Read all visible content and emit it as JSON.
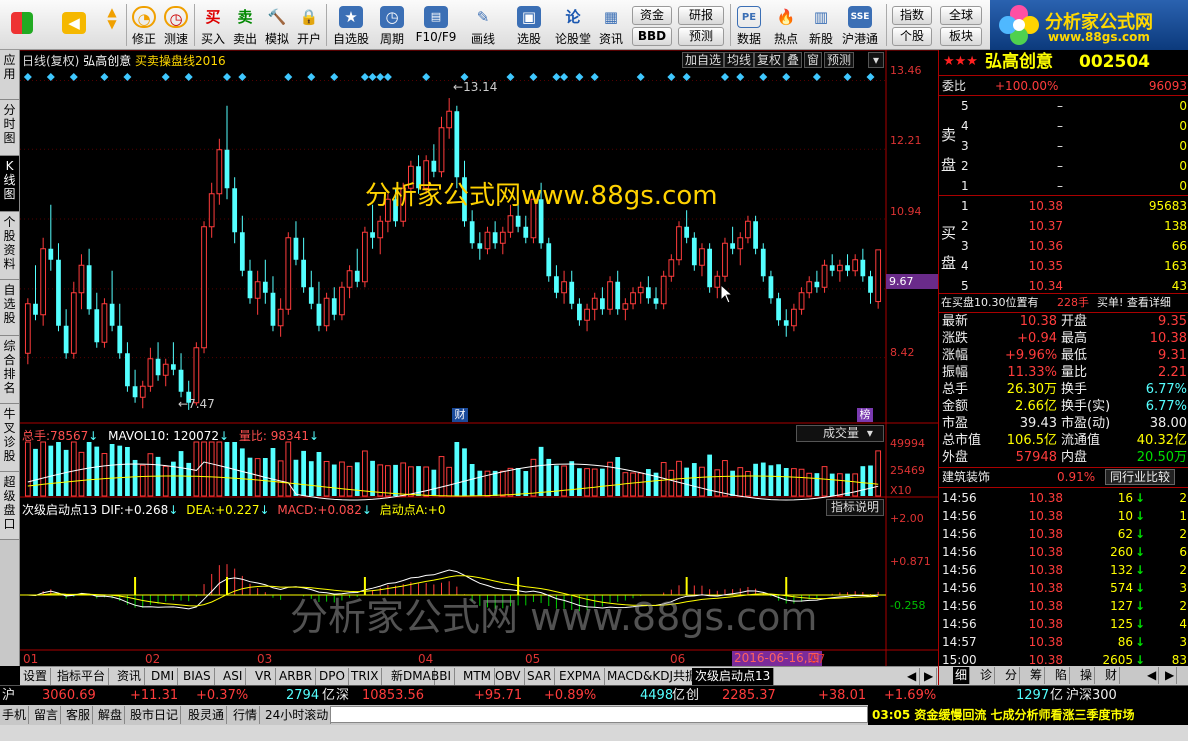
{
  "toolbar": {
    "buttons": [
      {
        "label": "",
        "icon": "windows-logo-icon"
      },
      {
        "label": "",
        "icon": "back-arrow-icon"
      },
      {
        "label": "",
        "icon": "up-down-arrow-icon"
      },
      {
        "label": "修正",
        "icon": "fix-icon"
      },
      {
        "label": "测速",
        "icon": "speedtest-clock-icon"
      },
      {
        "label": "买入",
        "icon": "buy-icon",
        "glyph": "买"
      },
      {
        "label": "卖出",
        "icon": "sell-icon",
        "glyph": "卖"
      },
      {
        "label": "模拟",
        "icon": "hammer-icon"
      },
      {
        "label": "开户",
        "icon": "lock-icon"
      },
      {
        "label": "自选股",
        "icon": "star-icon"
      },
      {
        "label": "周期",
        "icon": "clock-icon"
      },
      {
        "label": "F10/F9",
        "icon": "f10-icon"
      },
      {
        "label": "画线",
        "icon": "pencil-icon"
      },
      {
        "label": "选股",
        "icon": "monitor-icon"
      },
      {
        "label": "论股堂",
        "icon": "discuss-icon",
        "glyph": "论"
      },
      {
        "label": "资讯",
        "icon": "document-icon"
      },
      {
        "label": "数据",
        "icon": "pe-icon",
        "glyph": "PE"
      },
      {
        "label": "热点",
        "icon": "fire-icon"
      },
      {
        "label": "新股",
        "icon": "newstock-icon"
      },
      {
        "label": "沪港通",
        "icon": "shhk-icon"
      }
    ],
    "small_buttons": [
      "资金",
      "BBD",
      "研报",
      "预测",
      "指数",
      "个股",
      "全球",
      "板块"
    ]
  },
  "logo": {
    "title": "分析家公式网",
    "url": "www.88gs.com"
  },
  "left_tabs": [
    "应用",
    "分时图",
    "K线图",
    "个股资料",
    "自选股",
    "综合排名",
    "牛叉诊股",
    "超级盘口"
  ],
  "active_left_tab": "K线图",
  "chart": {
    "title_prefix": "日线(复权)",
    "stock_name": "弘高创意",
    "indicator_name": "买卖操盘线2016",
    "top_tools": [
      "加自选",
      "均线",
      "复权",
      "叠",
      "窗",
      "预测"
    ],
    "price_axis": [
      "13.46",
      "12.21",
      "10.94",
      "9.67",
      "8.42"
    ],
    "current_price_tag": "9.67",
    "high_label": "13.14",
    "low_label": "7.47",
    "watermark_top": "分析家公式网www.88gs.com",
    "watermark_bottom": "分析家公式网 www.88gs.com",
    "cai_badge": "财",
    "bang_badge": "榜",
    "vol_header": {
      "label": "总手:",
      "value": "78567",
      "ma_label": "MAVOL10:",
      "ma_value": "120072",
      "ratio_label": "量比:",
      "ratio_value": "98341"
    },
    "vol_dropdown": "成交量",
    "vol_axis": [
      "49994",
      "25469",
      "X10"
    ],
    "macd_header": {
      "name": "次级启动点13",
      "dif_label": "DIF:",
      "dif": "+0.268",
      "dea_label": "DEA:",
      "dea": "+0.227",
      "macd_label": "MACD:",
      "macd": "+0.082",
      "qd_label": "启动点A:",
      "qd": "+0"
    },
    "macd_button": "指标说明",
    "macd_axis": [
      "+2.00",
      "+0.871",
      "-0.258"
    ],
    "months": [
      "01",
      "02",
      "03",
      "04",
      "05",
      "06",
      "07"
    ],
    "date_tag": "2016-06-16,四"
  },
  "bottom_tabs": [
    "设置",
    "指标平台",
    "资讯",
    "DMI",
    "BIAS",
    "ASI",
    "VR",
    "ARBR",
    "DPO",
    "TRIX",
    "新DMA",
    "BBI",
    "MTM",
    "OBV",
    "SAR",
    "EXPMA",
    "MACD&KDJ共振",
    "次级启动点13"
  ],
  "active_bottom_tab": "次级启动点13",
  "right_panel": {
    "stars": "★★★",
    "name": "弘高创意",
    "code": "002504",
    "weibi_label": "委比",
    "weibi": "+100.00%",
    "weicha": "96093",
    "sell_label": [
      "卖",
      "盘"
    ],
    "buy_label": [
      "买",
      "盘"
    ],
    "sells": [
      {
        "lvl": "5",
        "price": "–",
        "vol": "0"
      },
      {
        "lvl": "4",
        "price": "–",
        "vol": "0"
      },
      {
        "lvl": "3",
        "price": "–",
        "vol": "0"
      },
      {
        "lvl": "2",
        "price": "–",
        "vol": "0"
      },
      {
        "lvl": "1",
        "price": "–",
        "vol": "0"
      }
    ],
    "buys": [
      {
        "lvl": "1",
        "price": "10.38",
        "vol": "95683"
      },
      {
        "lvl": "2",
        "price": "10.37",
        "vol": "138"
      },
      {
        "lvl": "3",
        "price": "10.36",
        "vol": "66"
      },
      {
        "lvl": "4",
        "price": "10.35",
        "vol": "163"
      },
      {
        "lvl": "5",
        "price": "10.34",
        "vol": "43"
      }
    ],
    "queue_text": "在买盘10.30位置有",
    "queue_vol": "228手",
    "queue_tail": "买单! 查看详细",
    "quotes": [
      {
        "l1": "最新",
        "v1": "10.38",
        "l2": "开盘",
        "v2": "9.35"
      },
      {
        "l1": "涨跌",
        "v1": "+0.94",
        "l2": "最高",
        "v2": "10.38"
      },
      {
        "l1": "涨幅",
        "v1": "+9.96%",
        "l2": "最低",
        "v2": "9.31"
      },
      {
        "l1": "振幅",
        "v1": "11.33%",
        "l2": "量比",
        "v2": "2.21"
      },
      {
        "l1": "总手",
        "v1": "26.30万",
        "l2": "换手",
        "v2": "6.77%"
      },
      {
        "l1": "金额",
        "v1": "2.66亿",
        "l2": "换手(实)",
        "v2": "6.77%"
      },
      {
        "l1": "市盈",
        "v1": "39.43",
        "l2": "市盈(动)",
        "v2": "38.00"
      },
      {
        "l1": "总市值",
        "v1": "106.5亿",
        "l2": "流通值",
        "v2": "40.32亿"
      },
      {
        "l1": "外盘",
        "v1": "57948",
        "l2": "内盘",
        "v2": "20.50万"
      }
    ],
    "industry": "建筑装饰",
    "industry_pct": "0.91%",
    "industry_btn": "同行业比较",
    "ticks": [
      {
        "t": "14:56",
        "p": "10.38",
        "v": "16",
        "n": "2"
      },
      {
        "t": "14:56",
        "p": "10.38",
        "v": "10",
        "n": "1"
      },
      {
        "t": "14:56",
        "p": "10.38",
        "v": "62",
        "n": "2"
      },
      {
        "t": "14:56",
        "p": "10.38",
        "v": "260",
        "n": "6"
      },
      {
        "t": "14:56",
        "p": "10.38",
        "v": "132",
        "n": "2"
      },
      {
        "t": "14:56",
        "p": "10.38",
        "v": "574",
        "n": "3"
      },
      {
        "t": "14:56",
        "p": "10.38",
        "v": "127",
        "n": "2"
      },
      {
        "t": "14:56",
        "p": "10.38",
        "v": "125",
        "n": "4"
      },
      {
        "t": "14:57",
        "p": "10.38",
        "v": "86",
        "n": "3"
      },
      {
        "t": "15:00",
        "p": "10.38",
        "v": "2605",
        "n": "83"
      }
    ],
    "tabs": [
      "细",
      "诊",
      "分",
      "筹",
      "陷",
      "操",
      "财"
    ]
  },
  "status1": {
    "sh_label": "沪",
    "sh": "3060.69",
    "sh_chg": "+11.31",
    "sh_pct": "+0.37%",
    "sh_amt": "2794",
    "yi": "亿",
    "sz_label": "深",
    "sz": "10853.56",
    "sz_chg": "+95.71",
    "sz_pct": "+0.89%",
    "sz_amt": "4498",
    "cy_label": "创",
    "cy": "2285.37",
    "cy_chg": "+38.01",
    "cy_pct": "+1.69%",
    "cy_amt": "1297",
    "hs300": "沪深300"
  },
  "status2": {
    "buttons": [
      "手机",
      "留言",
      "客服",
      "解盘",
      "股市日记",
      "股灵通",
      "行情",
      "24小时滚动"
    ],
    "news": "03:05 资金缓慢回流 七成分析师看涨三季度市场"
  },
  "candles": [
    [
      8.5,
      9.5,
      8.3,
      9.4
    ],
    [
      9.4,
      10.1,
      9.1,
      9.2
    ],
    [
      9.2,
      10.6,
      9.0,
      10.4
    ],
    [
      10.4,
      11.2,
      10.0,
      10.2
    ],
    [
      10.2,
      10.5,
      8.9,
      9.0
    ],
    [
      9.0,
      9.3,
      8.4,
      8.5
    ],
    [
      8.5,
      9.8,
      8.4,
      9.6
    ],
    [
      9.6,
      10.3,
      9.3,
      10.1
    ],
    [
      10.1,
      10.4,
      9.2,
      9.3
    ],
    [
      9.3,
      9.6,
      8.6,
      8.7
    ],
    [
      8.7,
      9.5,
      8.6,
      9.4
    ],
    [
      9.4,
      10.0,
      8.9,
      9.0
    ],
    [
      9.0,
      9.4,
      8.4,
      8.5
    ],
    [
      8.5,
      8.7,
      7.8,
      7.9
    ],
    [
      7.9,
      8.2,
      7.6,
      7.7
    ],
    [
      7.7,
      8.0,
      7.5,
      7.9
    ],
    [
      7.9,
      8.6,
      7.8,
      8.4
    ],
    [
      8.4,
      8.7,
      8.0,
      8.1
    ],
    [
      8.1,
      8.4,
      7.9,
      8.3
    ],
    [
      8.3,
      8.7,
      8.1,
      8.2
    ],
    [
      8.2,
      8.5,
      7.7,
      7.8
    ],
    [
      7.8,
      8.0,
      7.47,
      7.6
    ],
    [
      7.6,
      8.7,
      7.55,
      8.6
    ],
    [
      8.6,
      10.9,
      8.5,
      10.8
    ],
    [
      10.8,
      11.6,
      10.6,
      11.4
    ],
    [
      11.4,
      12.4,
      11.2,
      12.2
    ],
    [
      12.2,
      13.0,
      11.3,
      11.5
    ],
    [
      11.5,
      11.7,
      10.5,
      10.7
    ],
    [
      10.7,
      11.0,
      9.9,
      10.0
    ],
    [
      10.0,
      10.2,
      9.4,
      9.5
    ],
    [
      9.5,
      10.0,
      9.2,
      9.8
    ],
    [
      9.8,
      10.2,
      9.4,
      9.6
    ],
    [
      9.6,
      9.9,
      8.9,
      9.0
    ],
    [
      9.0,
      9.5,
      8.8,
      9.3
    ],
    [
      9.3,
      10.7,
      9.2,
      10.6
    ],
    [
      10.6,
      10.9,
      10.1,
      10.2
    ],
    [
      10.2,
      10.6,
      9.6,
      9.7
    ],
    [
      9.7,
      10.0,
      9.3,
      9.4
    ],
    [
      9.4,
      9.8,
      8.9,
      9.0
    ],
    [
      9.0,
      9.6,
      8.9,
      9.5
    ],
    [
      9.5,
      9.7,
      9.1,
      9.2
    ],
    [
      9.2,
      9.8,
      9.1,
      9.7
    ],
    [
      9.7,
      10.1,
      9.5,
      10.0
    ],
    [
      10.0,
      10.4,
      9.7,
      9.8
    ],
    [
      9.8,
      10.8,
      9.7,
      10.7
    ],
    [
      10.7,
      11.2,
      10.4,
      10.6
    ],
    [
      10.6,
      11.0,
      10.3,
      10.9
    ],
    [
      10.9,
      11.4,
      10.7,
      11.3
    ],
    [
      11.3,
      11.5,
      10.8,
      10.9
    ],
    [
      10.9,
      11.6,
      10.8,
      11.5
    ],
    [
      11.5,
      12.0,
      11.3,
      11.9
    ],
    [
      11.9,
      12.1,
      11.4,
      11.5
    ],
    [
      11.5,
      12.1,
      11.4,
      12.0
    ],
    [
      12.0,
      12.3,
      11.7,
      11.8
    ],
    [
      11.8,
      12.8,
      11.7,
      12.6
    ],
    [
      12.6,
      13.14,
      12.4,
      12.9
    ],
    [
      12.9,
      13.0,
      11.5,
      11.7
    ],
    [
      11.7,
      12.0,
      10.8,
      10.9
    ],
    [
      10.9,
      11.1,
      10.4,
      10.5
    ],
    [
      10.5,
      10.7,
      10.2,
      10.4
    ],
    [
      10.4,
      10.8,
      10.3,
      10.7
    ],
    [
      10.7,
      10.9,
      10.4,
      10.5
    ],
    [
      10.5,
      10.8,
      10.3,
      10.7
    ],
    [
      10.7,
      11.2,
      10.6,
      11.0
    ],
    [
      11.0,
      11.3,
      10.7,
      10.8
    ],
    [
      10.8,
      11.0,
      10.5,
      10.6
    ],
    [
      10.6,
      11.4,
      10.5,
      11.3
    ],
    [
      11.3,
      11.6,
      10.4,
      10.5
    ],
    [
      10.5,
      10.6,
      9.8,
      9.9
    ],
    [
      9.9,
      10.1,
      9.5,
      9.6
    ],
    [
      9.6,
      10.0,
      9.4,
      9.8
    ],
    [
      9.8,
      10.0,
      9.3,
      9.4
    ],
    [
      9.4,
      9.5,
      9.0,
      9.1
    ],
    [
      9.1,
      9.4,
      8.9,
      9.3
    ],
    [
      9.3,
      9.6,
      9.1,
      9.5
    ],
    [
      9.5,
      9.7,
      9.2,
      9.3
    ],
    [
      9.3,
      9.9,
      9.2,
      9.8
    ],
    [
      9.8,
      10.0,
      9.2,
      9.3
    ],
    [
      9.3,
      9.5,
      9.1,
      9.4
    ],
    [
      9.4,
      9.7,
      9.3,
      9.6
    ],
    [
      9.6,
      9.8,
      9.4,
      9.7
    ],
    [
      9.7,
      9.9,
      9.4,
      9.5
    ],
    [
      9.5,
      9.7,
      9.3,
      9.4
    ],
    [
      9.4,
      10.0,
      9.3,
      9.9
    ],
    [
      9.9,
      10.3,
      9.8,
      10.2
    ],
    [
      10.2,
      10.9,
      10.1,
      10.8
    ],
    [
      10.8,
      11.1,
      10.5,
      10.6
    ],
    [
      10.6,
      10.7,
      10.0,
      10.1
    ],
    [
      10.1,
      10.5,
      9.9,
      10.4
    ],
    [
      10.4,
      10.5,
      9.6,
      9.7
    ],
    [
      9.7,
      10.0,
      9.5,
      9.9
    ],
    [
      9.9,
      10.6,
      9.8,
      10.5
    ],
    [
      10.5,
      10.8,
      10.3,
      10.4
    ],
    [
      10.4,
      10.7,
      10.1,
      10.6
    ],
    [
      10.6,
      11.0,
      10.5,
      10.9
    ],
    [
      10.9,
      11.0,
      10.3,
      10.4
    ],
    [
      10.4,
      10.5,
      9.8,
      9.9
    ],
    [
      9.9,
      10.0,
      9.4,
      9.5
    ],
    [
      9.5,
      9.6,
      9.0,
      9.1
    ],
    [
      9.1,
      9.3,
      8.8,
      9.0
    ],
    [
      9.0,
      9.4,
      8.9,
      9.3
    ],
    [
      9.3,
      9.7,
      9.2,
      9.6
    ],
    [
      9.6,
      9.9,
      9.5,
      9.8
    ],
    [
      9.8,
      10.0,
      9.6,
      9.7
    ],
    [
      9.7,
      10.2,
      9.6,
      10.1
    ],
    [
      10.1,
      10.3,
      9.9,
      10.0
    ],
    [
      10.0,
      10.2,
      9.8,
      10.1
    ],
    [
      10.1,
      10.3,
      9.9,
      10.0
    ],
    [
      10.0,
      10.3,
      9.9,
      10.2
    ],
    [
      10.2,
      10.4,
      9.8,
      9.9
    ],
    [
      9.9,
      10.0,
      9.4,
      9.6
    ],
    [
      9.44,
      10.38,
      9.31,
      10.38
    ]
  ]
}
